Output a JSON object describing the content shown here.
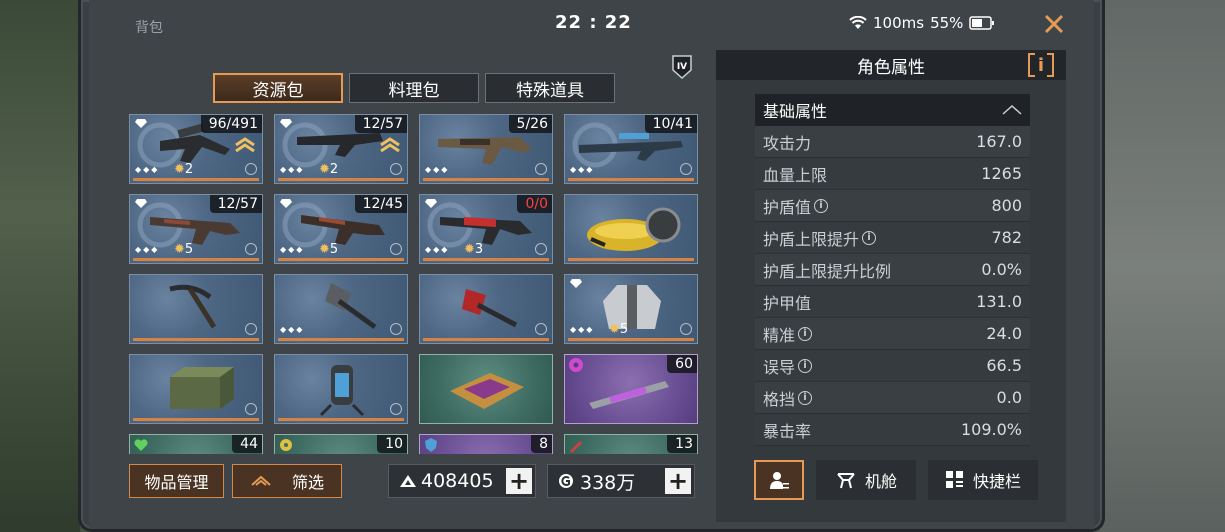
{
  "status": {
    "title": "背包",
    "time": "22 : 22",
    "ping": "100ms",
    "battery": "55%"
  },
  "tabs": [
    {
      "label": "资源包",
      "active": true
    },
    {
      "label": "料理包",
      "active": false
    },
    {
      "label": "特殊道具",
      "active": false
    }
  ],
  "tier_badge": "IV",
  "items": [
    {
      "id": "rifle-1",
      "count": "96/491",
      "stars": "2",
      "rank": true
    },
    {
      "id": "rifle-2",
      "count": "12/57",
      "stars": "2",
      "rank": true
    },
    {
      "id": "rifle-3",
      "count": "5/26"
    },
    {
      "id": "sniper-1",
      "count": "10/41"
    },
    {
      "id": "rifle-4",
      "count": "12/57",
      "stars": "5"
    },
    {
      "id": "rifle-5",
      "count": "12/45",
      "stars": "5"
    },
    {
      "id": "rifle-6",
      "count": "0/0",
      "stars": "3",
      "count_color": "red"
    },
    {
      "id": "scooter"
    },
    {
      "id": "pickaxe"
    },
    {
      "id": "axe"
    },
    {
      "id": "hammer"
    },
    {
      "id": "armor",
      "stars": "5"
    },
    {
      "id": "crate"
    },
    {
      "id": "canister"
    },
    {
      "id": "card"
    },
    {
      "id": "syringe",
      "count": "60"
    },
    {
      "id": "row5-1",
      "count": "44"
    },
    {
      "id": "row5-2",
      "count": "10"
    },
    {
      "id": "row5-3",
      "count": "8"
    },
    {
      "id": "row5-4",
      "count": "13"
    }
  ],
  "buttons": {
    "manage": "物品管理",
    "filter": "筛选"
  },
  "currency": {
    "primary": "408405",
    "secondary": "338万",
    "add": "+"
  },
  "panel": {
    "title": "角色属性",
    "info_label": "i",
    "section": "基础属性",
    "rows": [
      {
        "name": "攻击力",
        "value": "167.0",
        "info": false
      },
      {
        "name": "血量上限",
        "value": "1265",
        "info": false
      },
      {
        "name": "护盾值",
        "value": "800",
        "info": true
      },
      {
        "name": "护盾上限提升",
        "value": "782",
        "info": true
      },
      {
        "name": "护盾上限提升比例",
        "value": "0.0%",
        "info": false
      },
      {
        "name": "护甲值",
        "value": "131.0",
        "info": false
      },
      {
        "name": "精准",
        "value": "24.0",
        "info": true
      },
      {
        "name": "误导",
        "value": "66.5",
        "info": true
      },
      {
        "name": "格挡",
        "value": "0.0",
        "info": true
      },
      {
        "name": "暴击率",
        "value": "109.0%",
        "info": false
      }
    ],
    "bottom_tabs": [
      {
        "label": "",
        "icon": "character-icon",
        "active": true
      },
      {
        "label": "机舱",
        "icon": "drone-icon",
        "active": false
      },
      {
        "label": "快捷栏",
        "icon": "shortcut-icon",
        "active": false
      }
    ]
  },
  "colors": {
    "accent": "#e59a55",
    "item_blue": "#4d6784",
    "item_green": "#3f6c62",
    "item_purple": "#6a4f94"
  }
}
